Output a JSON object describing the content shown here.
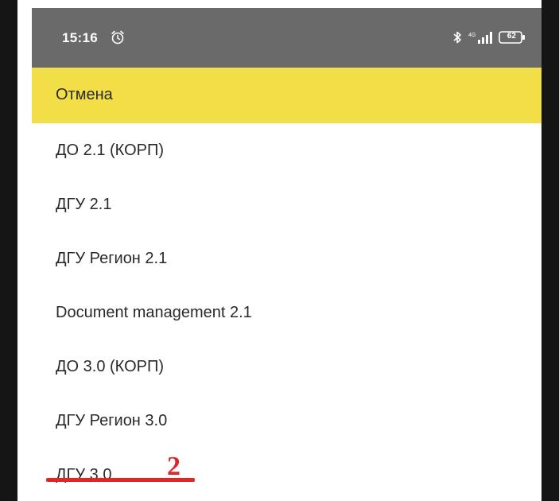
{
  "statusbar": {
    "time": "15:16",
    "battery_level": "62",
    "icons": [
      "alarm-icon",
      "bluetooth-icon",
      "signal-icon",
      "battery-icon"
    ]
  },
  "actionbar": {
    "cancel_label": "Отмена"
  },
  "list": {
    "items": [
      {
        "label": "ДО 2.1 (КОРП)"
      },
      {
        "label": "ДГУ 2.1"
      },
      {
        "label": "ДГУ Регион 2.1"
      },
      {
        "label": "Document management 2.1"
      },
      {
        "label": "ДО 3.0 (КОРП)"
      },
      {
        "label": "ДГУ Регион 3.0"
      },
      {
        "label": "ДГУ 3.0"
      }
    ]
  },
  "annotation": {
    "number": "2"
  },
  "colors": {
    "statusbar": "#6a6a6a",
    "actionbar": "#f2df48",
    "annotation": "#e02626",
    "bezel": "#151515"
  }
}
